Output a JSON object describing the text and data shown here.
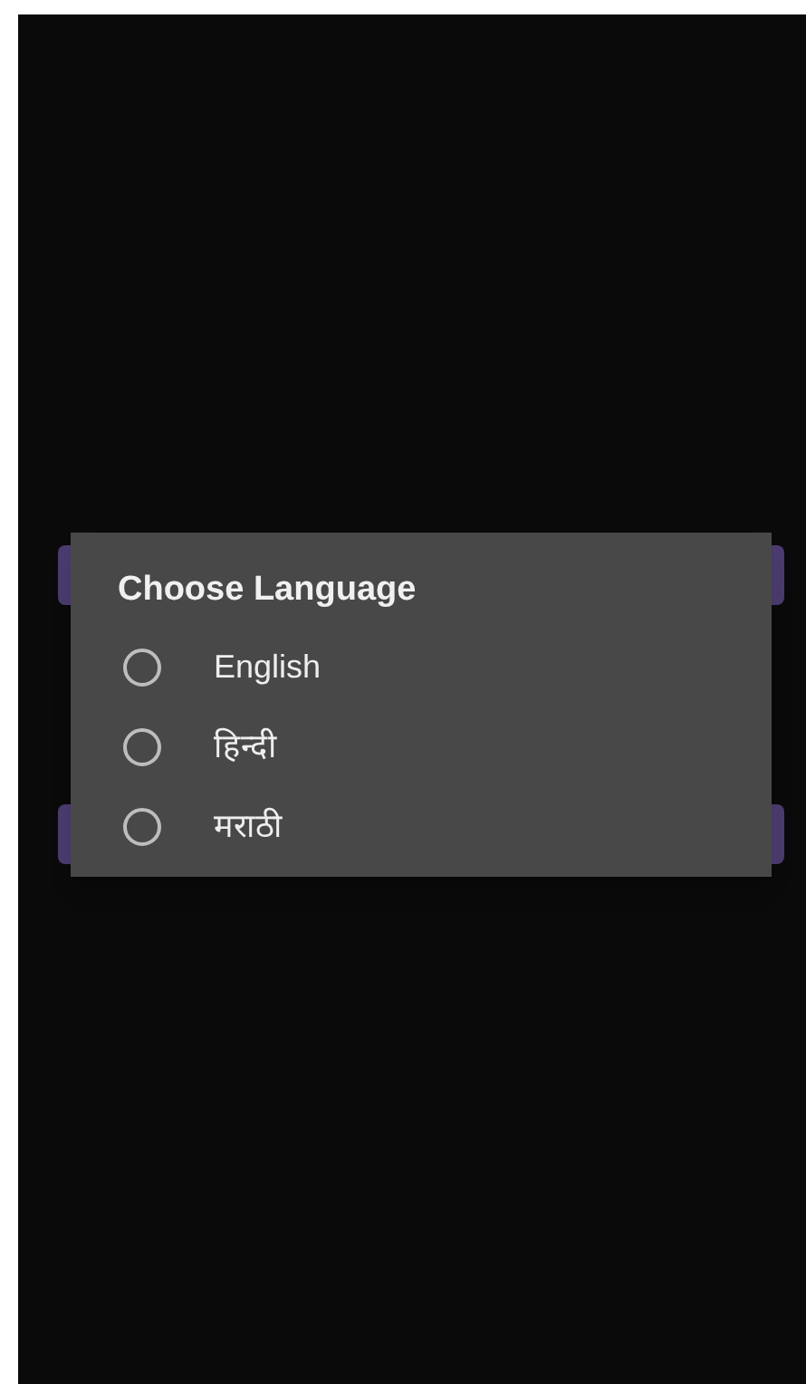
{
  "dialog": {
    "title": "Choose Language",
    "options": [
      {
        "label": "English",
        "selected": false
      },
      {
        "label": "हिन्दी",
        "selected": false
      },
      {
        "label": "मराठी",
        "selected": false
      }
    ]
  }
}
